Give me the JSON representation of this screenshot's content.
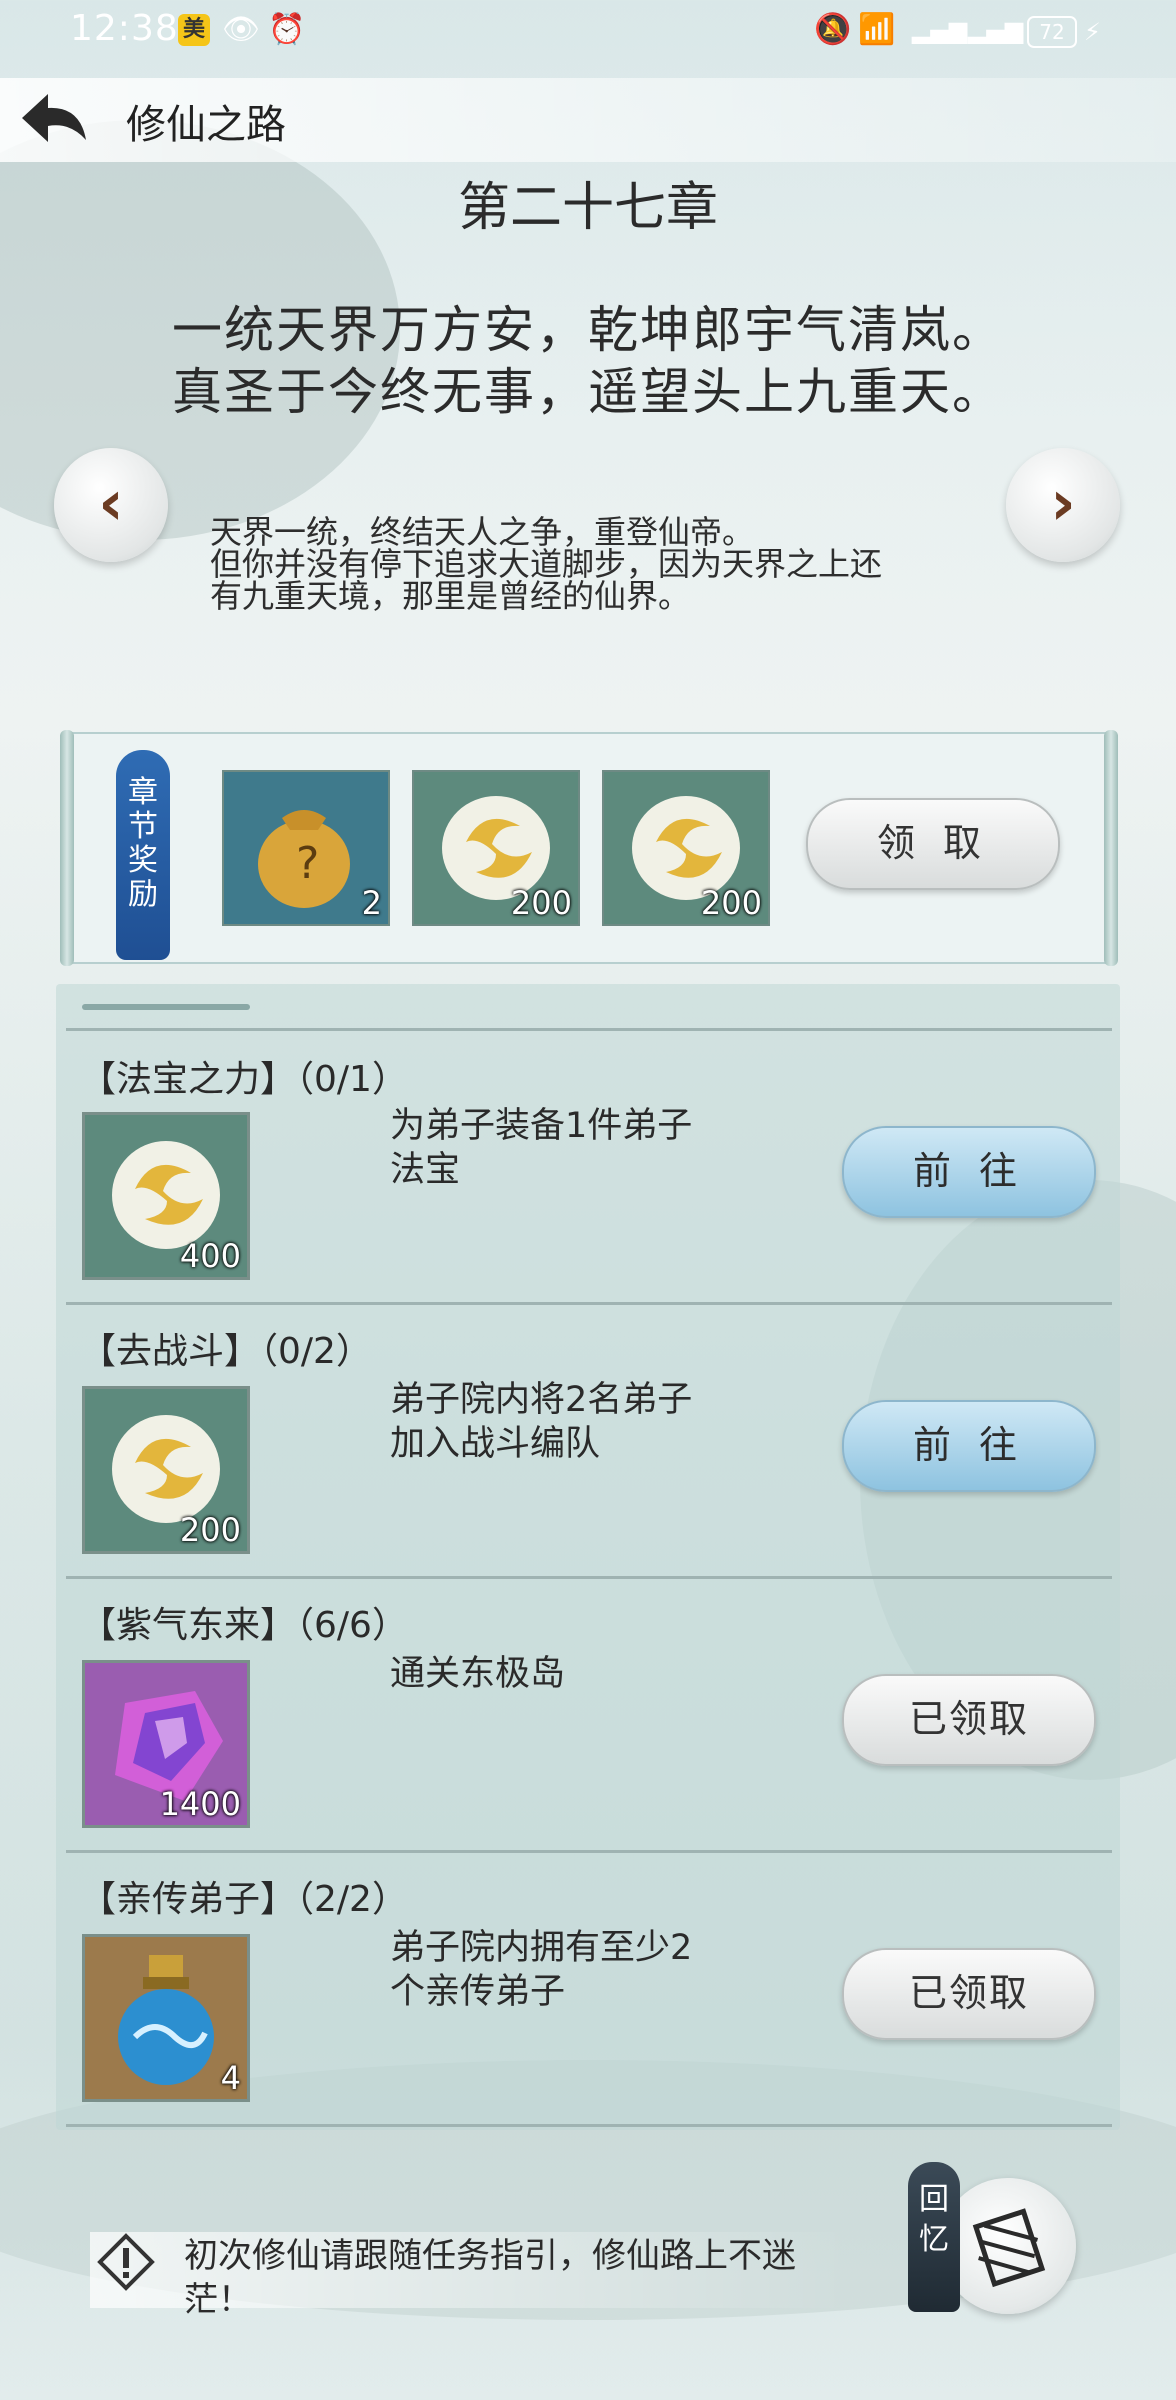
{
  "status_bar": {
    "time": "12:38",
    "app_badge": "美",
    "battery": "72"
  },
  "header": {
    "title": "修仙之路",
    "back_icon": "back-arrow-icon"
  },
  "chapter": {
    "title": "第二十七章",
    "poem_line1": "一统天界万方安，乾坤郎宇气清岚。",
    "poem_line2": "真圣于今终无事，遥望头上九重天。",
    "desc_line1": "天界一统，终结天人之争，重登仙帝。",
    "desc_line2": "但你并没有停下追求大道脚步，因为天界之上还",
    "desc_line3": "有九重天境，那里是曾经的仙界。",
    "prev_icon": "chevron-left-icon",
    "next_icon": "chevron-right-icon"
  },
  "chapter_reward": {
    "tag": "章节奖励",
    "items": [
      {
        "icon": "lucky-bag-icon",
        "count": "2"
      },
      {
        "icon": "spirit-orb-icon",
        "count": "200"
      },
      {
        "icon": "spirit-orb-icon",
        "count": "200"
      }
    ],
    "button_label": "领 取"
  },
  "tasks": [
    {
      "title": "【法宝之力】（0/1）",
      "desc_line1": "为弟子装备1件弟子",
      "desc_line2": "法宝",
      "reward_icon": "spirit-orb-icon",
      "reward_count": "400",
      "button_label": "前 往",
      "state": "go"
    },
    {
      "title": "【去战斗】（0/2）",
      "desc_line1": "弟子院内将2名弟子",
      "desc_line2": "加入战斗编队",
      "reward_icon": "spirit-orb-icon",
      "reward_count": "200",
      "button_label": "前 往",
      "state": "go"
    },
    {
      "title": "【紫气东来】（6/6）",
      "desc_line1": "通关东极岛",
      "desc_line2": "",
      "reward_icon": "purple-crystal-icon",
      "reward_count": "1400",
      "button_label": "已领取",
      "state": "claimed"
    },
    {
      "title": "【亲传弟子】（2/2）",
      "desc_line1": "弟子院内拥有至少2",
      "desc_line2": "个亲传弟子",
      "reward_icon": "blue-potion-icon",
      "reward_count": "4",
      "button_label": "已领取",
      "state": "claimed"
    }
  ],
  "footer": {
    "tip_line1": "初次修仙请跟随任务指引，修仙路上不迷",
    "tip_line2": "茫！",
    "return_tag": "回忆",
    "warn_icon": "warning-icon",
    "return_icon": "scroll-icon"
  },
  "colors": {
    "accent_blue": "#8ec3e0",
    "arrow_brown": "#6b3b22",
    "orb_tile": "#5d8a7d",
    "crystal_tile": "#9a5db0",
    "potion_tile": "#9c7a4c"
  }
}
